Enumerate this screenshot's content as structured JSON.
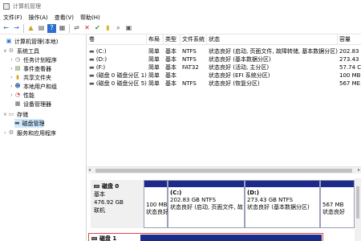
{
  "window": {
    "title": "计算机管理"
  },
  "menu": {
    "items": [
      "文件(F)",
      "操作(A)",
      "查看(V)",
      "帮助(H)"
    ]
  },
  "toolbar": {
    "back": "←",
    "forward": "→",
    "up": "▲",
    "show": "▤",
    "help": "?",
    "view": "▦",
    "remove": "✕",
    "check": "✔",
    "folder": "▮",
    "search": "⌕",
    "properties": "▣"
  },
  "tree": {
    "root": "计算机管理(本地)",
    "system_tools": "系统工具",
    "task_scheduler": "任务计划程序",
    "event_viewer": "事件查看器",
    "shared_folders": "共享文件夹",
    "local_users": "本地用户和组",
    "performance": "性能",
    "device_manager": "设备管理器",
    "storage": "存储",
    "disk_management": "磁盘管理",
    "services_apps": "服务和应用程序"
  },
  "volume_table": {
    "headers": [
      "卷",
      "布局",
      "类型",
      "文件系统",
      "状态",
      "容量"
    ],
    "rows": [
      [
        "(C:)",
        "简单",
        "基本",
        "NTFS",
        "状态良好 (启动, 页面文件, 故障转储, 基本数据分区)",
        "202.83"
      ],
      [
        "(D:)",
        "简单",
        "基本",
        "NTFS",
        "状态良好 (基本数据分区)",
        "273.43"
      ],
      [
        "(F:)",
        "简单",
        "基本",
        "FAT32",
        "状态良好 (活动, 主分区)",
        "57.74 C"
      ],
      [
        "(磁盘 0 磁盘分区 1)",
        "简单",
        "基本",
        "",
        "状态良好 (EFI 系统分区)",
        "100 MB"
      ],
      [
        "(磁盘 0 磁盘分区 5)",
        "简单",
        "基本",
        "NTFS",
        "状态良好 (恢复分区)",
        "567 ME"
      ]
    ]
  },
  "disk0": {
    "name": "磁盘 0",
    "type": "基本",
    "size": "476.92 GB",
    "status": "联机",
    "partitions": [
      {
        "title": "",
        "size": "100 MB",
        "status": "状态良好"
      },
      {
        "title": "(C:)",
        "size": "202.83 GB NTFS",
        "status": "状态良好 (启动, 页面文件, 故"
      },
      {
        "title": "(D:)",
        "size": "273.43 GB NTFS",
        "status": "状态良好 (基本数据分区)"
      },
      {
        "title": "",
        "size": "567 MB",
        "status": "状态良好"
      }
    ]
  },
  "disk1": {
    "name": "磁盘 1"
  },
  "colors": {
    "partition_bar": "#1c2a8a",
    "selection": "#cce8ff",
    "disk1_border": "#e34545"
  }
}
